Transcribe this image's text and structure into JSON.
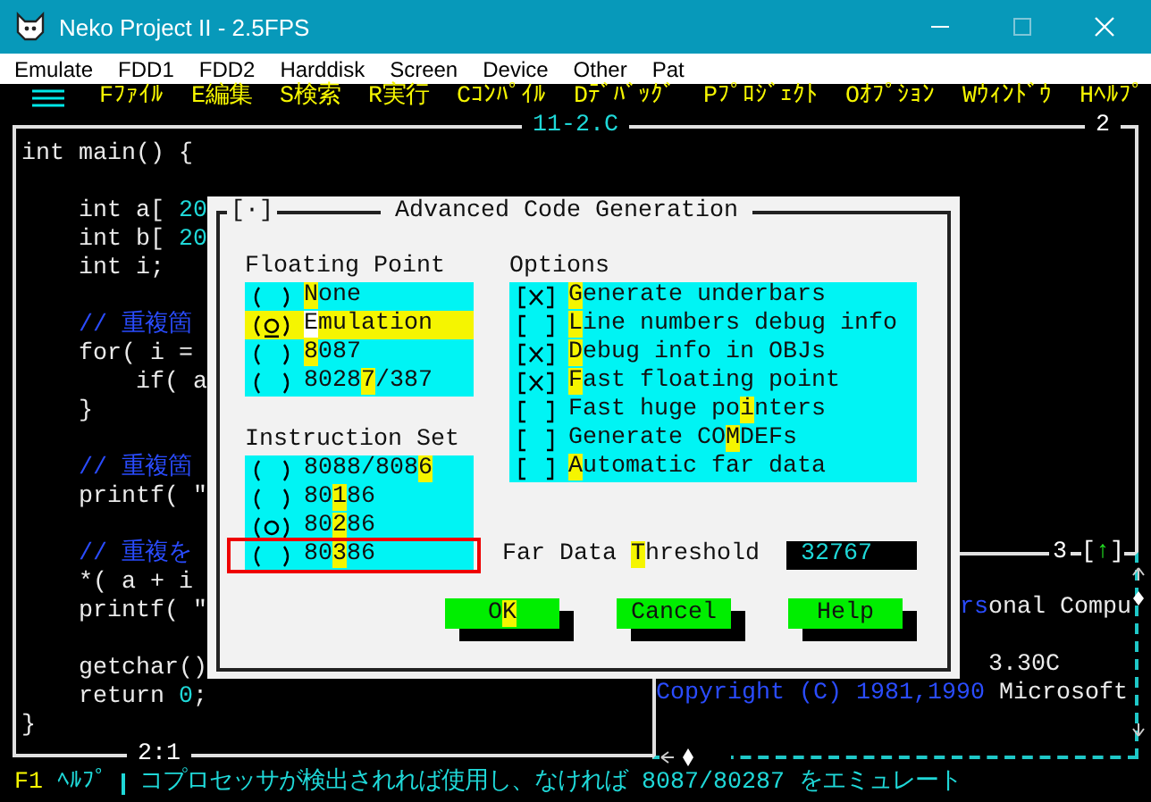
{
  "window": {
    "title": "Neko Project II - 2.5FPS"
  },
  "menu_bar": [
    "Emulate",
    "FDD1",
    "FDD2",
    "Harddisk",
    "Screen",
    "Device",
    "Other",
    "Pat"
  ],
  "dos_menu": [
    "Fﾌｧｲﾙ",
    "E編集",
    "S検索",
    "R実行",
    "Cｺﾝﾊﾟｲﾙ",
    "Dﾃﾞﾊﾞｯｸﾞ",
    "Pﾌﾟﾛｼﾞｪｸﾄ",
    "Oｵﾌﾟｼｮﾝ",
    "Wｳｨﾝﾄﾞｳ",
    "Hﾍﾙﾌﾟ"
  ],
  "editor": {
    "title": "11-2.C",
    "window_number": "2",
    "position": "2:1",
    "lines": [
      {
        "segments": [
          {
            "text": "int main() {",
            "kind": "code"
          }
        ]
      },
      {
        "blank_before": true,
        "segments": [
          {
            "text": "    int a[ ",
            "kind": "code"
          },
          {
            "text": "20",
            "kind": "number"
          }
        ]
      },
      {
        "segments": [
          {
            "text": "    int b[ ",
            "kind": "code"
          },
          {
            "text": "20",
            "kind": "number"
          }
        ]
      },
      {
        "segments": [
          {
            "text": "    int i;",
            "kind": "code"
          }
        ]
      },
      {
        "blank_before": true,
        "segments": [
          {
            "text": "    // 重複箇",
            "kind": "comment"
          }
        ]
      },
      {
        "segments": [
          {
            "text": "    for( i = ",
            "kind": "code"
          }
        ]
      },
      {
        "segments": [
          {
            "text": "        if( a",
            "kind": "code"
          }
        ]
      },
      {
        "segments": [
          {
            "text": "    }",
            "kind": "code"
          }
        ]
      },
      {
        "blank_before": true,
        "segments": [
          {
            "text": "    // 重複箇",
            "kind": "comment"
          }
        ]
      },
      {
        "segments": [
          {
            "text": "    printf( \"",
            "kind": "code"
          }
        ]
      },
      {
        "blank_before": true,
        "segments": [
          {
            "text": "    // 重複を",
            "kind": "comment"
          }
        ]
      },
      {
        "segments": [
          {
            "text": "    *( a + i",
            "kind": "code"
          }
        ]
      },
      {
        "segments": [
          {
            "text": "    printf( \"",
            "kind": "code"
          }
        ]
      },
      {
        "blank_before": true,
        "segments": [
          {
            "text": "    getchar()",
            "kind": "code"
          }
        ]
      },
      {
        "segments": [
          {
            "text": "    return ",
            "kind": "code"
          },
          {
            "text": "0",
            "kind": "number"
          },
          {
            "text": ";",
            "kind": "code"
          }
        ]
      },
      {
        "segments": [
          {
            "text": "}",
            "kind": "code"
          }
        ]
      }
    ]
  },
  "output_window": {
    "window_number": "3",
    "zoom_button": {
      "open": "[",
      "glyph": "↑",
      "close": "]"
    },
    "lines": [
      {
        "segments": [
          {
            "text": "rs",
            "kind": "blue"
          },
          {
            "text": "onal Compu",
            "kind": "plain"
          }
        ]
      },
      {
        "segments": [
          {
            "text": "3.30C",
            "kind": "plain"
          }
        ]
      },
      {
        "segments": [
          {
            "text": "Copyright (C) 1981,1990",
            "kind": "blue"
          },
          {
            "text": " Microsoft",
            "kind": "plain"
          }
        ]
      }
    ]
  },
  "dialog": {
    "close_box": "[·]",
    "title": "Advanced Code Generation",
    "floating_point": {
      "label": "Floating Point",
      "items": [
        {
          "key": "N",
          "post": "one",
          "selected": false,
          "focused": false
        },
        {
          "key": "E",
          "post": "mulation",
          "selected": true,
          "focused": true
        },
        {
          "key": "8",
          "post": "087",
          "selected": false,
          "focused": false
        },
        {
          "pre": "8028",
          "key": "7",
          "post": "/387",
          "selected": false,
          "focused": false
        }
      ]
    },
    "instruction_set": {
      "label": "Instruction Set",
      "items": [
        {
          "pre": "8088/808",
          "key": "6",
          "selected": false,
          "outlined": false
        },
        {
          "pre": "80",
          "key": "1",
          "post": "86",
          "selected": false,
          "outlined": false
        },
        {
          "pre": "80",
          "key": "2",
          "post": "86",
          "selected": true,
          "outlined": false
        },
        {
          "pre": "80",
          "key": "3",
          "post": "86",
          "selected": false,
          "outlined": true
        }
      ]
    },
    "options": {
      "label": "Options",
      "items": [
        {
          "key": "G",
          "post": "enerate underbars",
          "checked": true
        },
        {
          "key": "L",
          "post": "ine numbers debug info",
          "checked": false
        },
        {
          "key": "D",
          "post": "ebug info in OBJs",
          "checked": true
        },
        {
          "key": "F",
          "post": "ast floating point",
          "checked": true
        },
        {
          "pre": "Fast huge po",
          "key": "i",
          "post": "nters",
          "checked": false
        },
        {
          "pre": "Generate CO",
          "key": "M",
          "post": "DEFs",
          "checked": false
        },
        {
          "key": "A",
          "post": "utomatic far data",
          "checked": false
        }
      ]
    },
    "threshold": {
      "pre": "Far Data ",
      "key": "T",
      "post": "hreshold",
      "value": "32767"
    },
    "buttons": [
      {
        "pre": "O",
        "key": "K"
      },
      {
        "pre": "Cancel"
      },
      {
        "pre": "Help"
      }
    ]
  },
  "status_bar": {
    "key": "F1",
    "key_label": "ﾍﾙﾌﾟ",
    "message": "コプロセッサが検出されれば使用し、なければ 8087/80287 をエミュレート"
  }
}
